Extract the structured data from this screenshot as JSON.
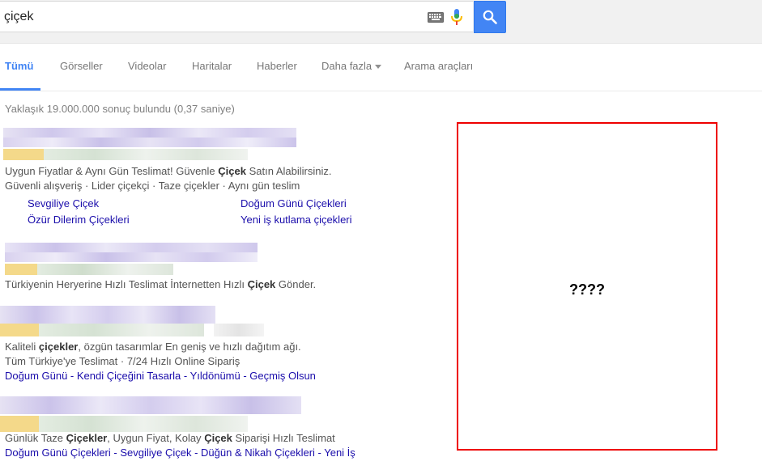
{
  "search": {
    "query": "çiçek"
  },
  "icons": {
    "keyboard": "keyboard-icon",
    "mic": "microphone-icon",
    "search": "search-icon"
  },
  "colors": {
    "accent": "#4285f4",
    "link": "#1a0dab",
    "red_box": "#ee0000"
  },
  "tabs": [
    {
      "label": "Tümü",
      "active": true
    },
    {
      "label": "Görseller"
    },
    {
      "label": "Videolar"
    },
    {
      "label": "Haritalar"
    },
    {
      "label": "Haberler"
    },
    {
      "label": "Daha fazla"
    },
    {
      "label": "Arama araçları"
    }
  ],
  "result_stats": "Yaklaşık 19.000.000 sonuç bulundu (0,37 saniye)",
  "results": [
    {
      "snippet_1_pre": "Uygun Fiyatlar & Aynı Gün Teslimat! Güvenle ",
      "snippet_1_bold": "Çiçek",
      "snippet_1_post": " Satın Alabilirsiniz.",
      "snippet_2": "Güvenli alışveriş · Lider çiçekçi · Taze çiçekler · Aynı gün teslim",
      "sitelinks": [
        "Sevgiliye Çiçek",
        "Doğum Günü Çiçekleri",
        "Özür Dilerim Çiçekleri",
        "Yeni iş kutlama çiçekleri"
      ]
    },
    {
      "snippet_1_pre": "Türkiyenin Heryerine Hızlı Teslimat İnternetten Hızlı ",
      "snippet_1_bold": "Çiçek",
      "snippet_1_post": " Gönder."
    },
    {
      "snippet_1_pre": "Kaliteli ",
      "snippet_1_bold": "çiçekler",
      "snippet_1_post": ", özgün tasarımlar En geniş ve hızlı dağıtım ağı.",
      "snippet_2": "Tüm Türkiye'ye Teslimat · 7/24 Hızlı Online Sipariş",
      "links_line": "Doğum Günü - Kendi Çiçeğini Tasarla - Yıldönümü - Geçmiş Olsun"
    },
    {
      "snippet_1_pre": "Günlük Taze ",
      "snippet_1_bold": "Çiçekler",
      "snippet_1_mid": ", Uygun Fiyat, Kolay ",
      "snippet_1_bold2": "Çiçek",
      "snippet_1_post": " Siparişi Hızlı Teslimat",
      "links_line": "Doğum Günü Çiçekleri - Sevgiliye Çiçek - Düğün & Nikah Çiçekleri - Yeni İş"
    }
  ],
  "red_box": {
    "text": "????"
  }
}
